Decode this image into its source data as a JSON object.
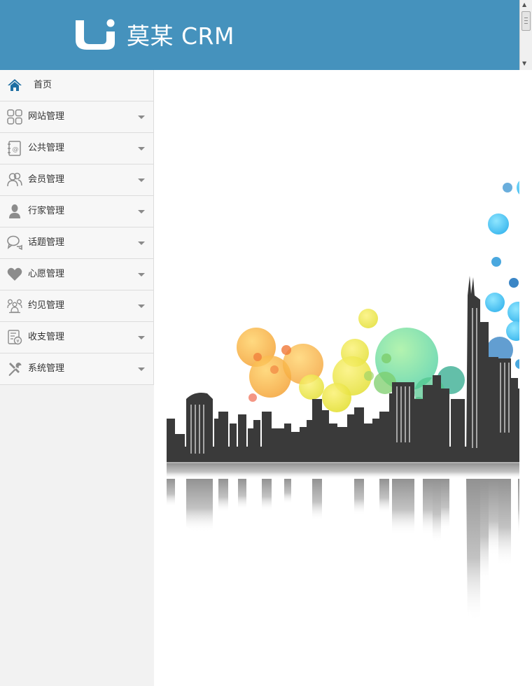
{
  "header": {
    "title": "莫某 CRM",
    "logo_icon": "logo-u-mark",
    "background": "#4592bd"
  },
  "sidebar": {
    "items": [
      {
        "label": "首页",
        "icon": "home-icon",
        "expandable": false
      },
      {
        "label": "网站管理",
        "icon": "grid-icon",
        "expandable": true
      },
      {
        "label": "公共管理",
        "icon": "address-book-icon",
        "expandable": true
      },
      {
        "label": "会员管理",
        "icon": "users-icon",
        "expandable": true
      },
      {
        "label": "行家管理",
        "icon": "user-icon",
        "expandable": true
      },
      {
        "label": "话题管理",
        "icon": "chat-icon",
        "expandable": true
      },
      {
        "label": "心愿管理",
        "icon": "heart-icon",
        "expandable": true
      },
      {
        "label": "约见管理",
        "icon": "meeting-icon",
        "expandable": true
      },
      {
        "label": "收支管理",
        "icon": "ledger-icon",
        "expandable": true
      },
      {
        "label": "系统管理",
        "icon": "tools-icon",
        "expandable": true
      }
    ]
  },
  "colors": {
    "accent": "#4592bd",
    "home_icon": "#1f6fa3",
    "menu_icon": "#8c8c8c"
  },
  "main": {
    "illustration": "city-skyline-with-colored-bubbles"
  }
}
